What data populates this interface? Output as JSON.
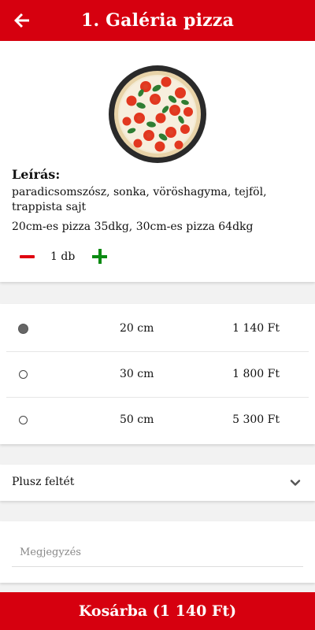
{
  "header": {
    "title": "1. Galéria pizza",
    "back_icon": "arrow-left-icon"
  },
  "product": {
    "image_icon": "pizza-image",
    "description_title": "Leírás:",
    "description": "paradicsomszósz, sonka, vöröshagyma, tejföl, trappista sajt",
    "sizes_note": "20cm-es pizza 35dkg, 30cm-es pizza 64dkg",
    "quantity": "1 db"
  },
  "sizes": [
    {
      "label": "20 cm",
      "price": "1 140 Ft",
      "selected": true
    },
    {
      "label": "30 cm",
      "price": "1 800 Ft",
      "selected": false
    },
    {
      "label": "50 cm",
      "price": "5 300 Ft",
      "selected": false
    }
  ],
  "toppings": {
    "label": "Plusz feltét"
  },
  "note": {
    "placeholder": "Megjegyzés",
    "value": ""
  },
  "cart": {
    "label": "Kosárba (1 140 Ft)"
  },
  "colors": {
    "brand": "#d6000f",
    "minus": "#e00010",
    "plus": "#0a8a12"
  }
}
